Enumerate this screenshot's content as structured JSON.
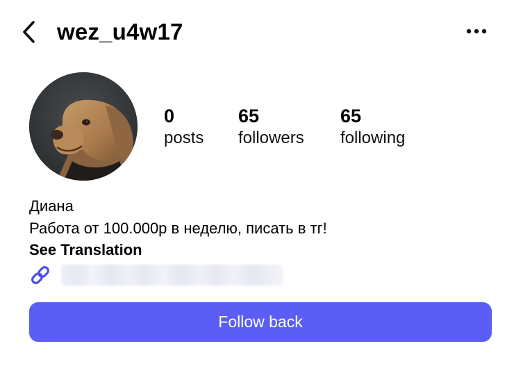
{
  "header": {
    "username": "wez_u4w17",
    "back_icon": "chevron-left-icon",
    "more_icon": "more-horizontal-icon"
  },
  "profile": {
    "avatar": "dog-photo",
    "stats": {
      "posts": {
        "count": "0",
        "label": "posts"
      },
      "followers": {
        "count": "65",
        "label": "followers"
      },
      "following": {
        "count": "65",
        "label": "following"
      }
    },
    "bio": {
      "name": "Диана",
      "text": "Работа от 100.000р в неделю, писать в тг!",
      "see_translation": "See Translation",
      "link_icon": "link-icon"
    },
    "follow_button": "Follow back"
  },
  "colors": {
    "accent": "#5b5ef4",
    "link_icon": "#4a4ee8",
    "text": "#000000",
    "background": "#ffffff"
  }
}
